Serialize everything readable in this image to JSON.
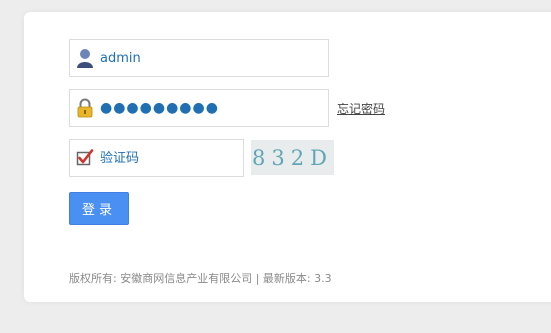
{
  "login": {
    "username_value": "admin",
    "password_value": "●●●●●●●●●",
    "captcha_placeholder": "验证码",
    "forgot_label": "忘记密码",
    "captcha_text": "832D",
    "submit_label": "登录"
  },
  "footer": {
    "copyright": "版权所有: 安徽商网信息产业有限公司 | 最新版本: 3.3"
  },
  "icons": {
    "username": "user-icon",
    "password": "lock-icon",
    "captcha": "checkbox-check-icon"
  },
  "colors": {
    "accent": "#4a8ff2",
    "field_text": "#1f6fb2",
    "check_red": "#d0342c",
    "lock_yellow": "#e9b62a"
  }
}
